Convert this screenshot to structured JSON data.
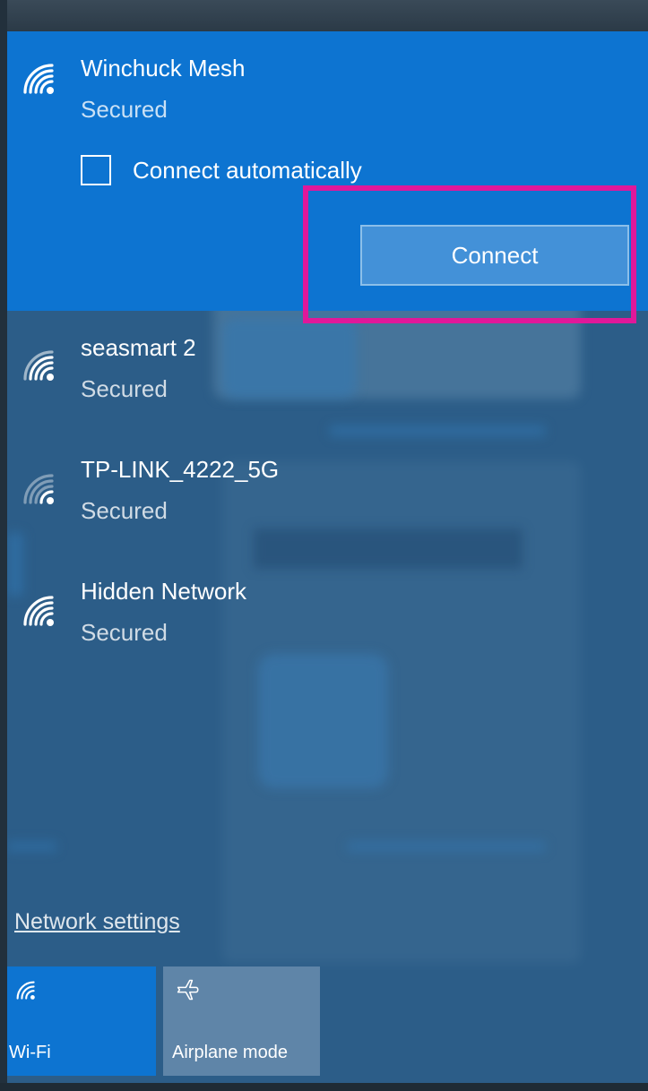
{
  "networks": [
    {
      "name": "Winchuck Mesh",
      "status": "Secured",
      "selected": true,
      "icon": "wifi-signal-icon"
    },
    {
      "name": "seasmart 2",
      "status": "Secured",
      "selected": false,
      "icon": "wifi-signal-icon"
    },
    {
      "name": "TP-LINK_4222_5G",
      "status": "Secured",
      "selected": false,
      "icon": "wifi-signal-weak-icon"
    },
    {
      "name": "Hidden Network",
      "status": "Secured",
      "selected": false,
      "icon": "wifi-signal-icon"
    }
  ],
  "selected_network": {
    "connect_automatically_label": "Connect automatically",
    "connect_automatically_checked": false,
    "connect_button_label": "Connect"
  },
  "network_settings_link": "Network settings",
  "quick_actions": [
    {
      "label": "Wi-Fi",
      "active": true,
      "icon": "wifi-icon"
    },
    {
      "label": "Airplane mode",
      "active": false,
      "icon": "airplane-icon"
    }
  ],
  "colors": {
    "selected_bg": "#0d74d1",
    "panel_bg": "#2c5d88",
    "highlight_border": "#e0189a",
    "connect_button_bg": "#4391d8"
  }
}
